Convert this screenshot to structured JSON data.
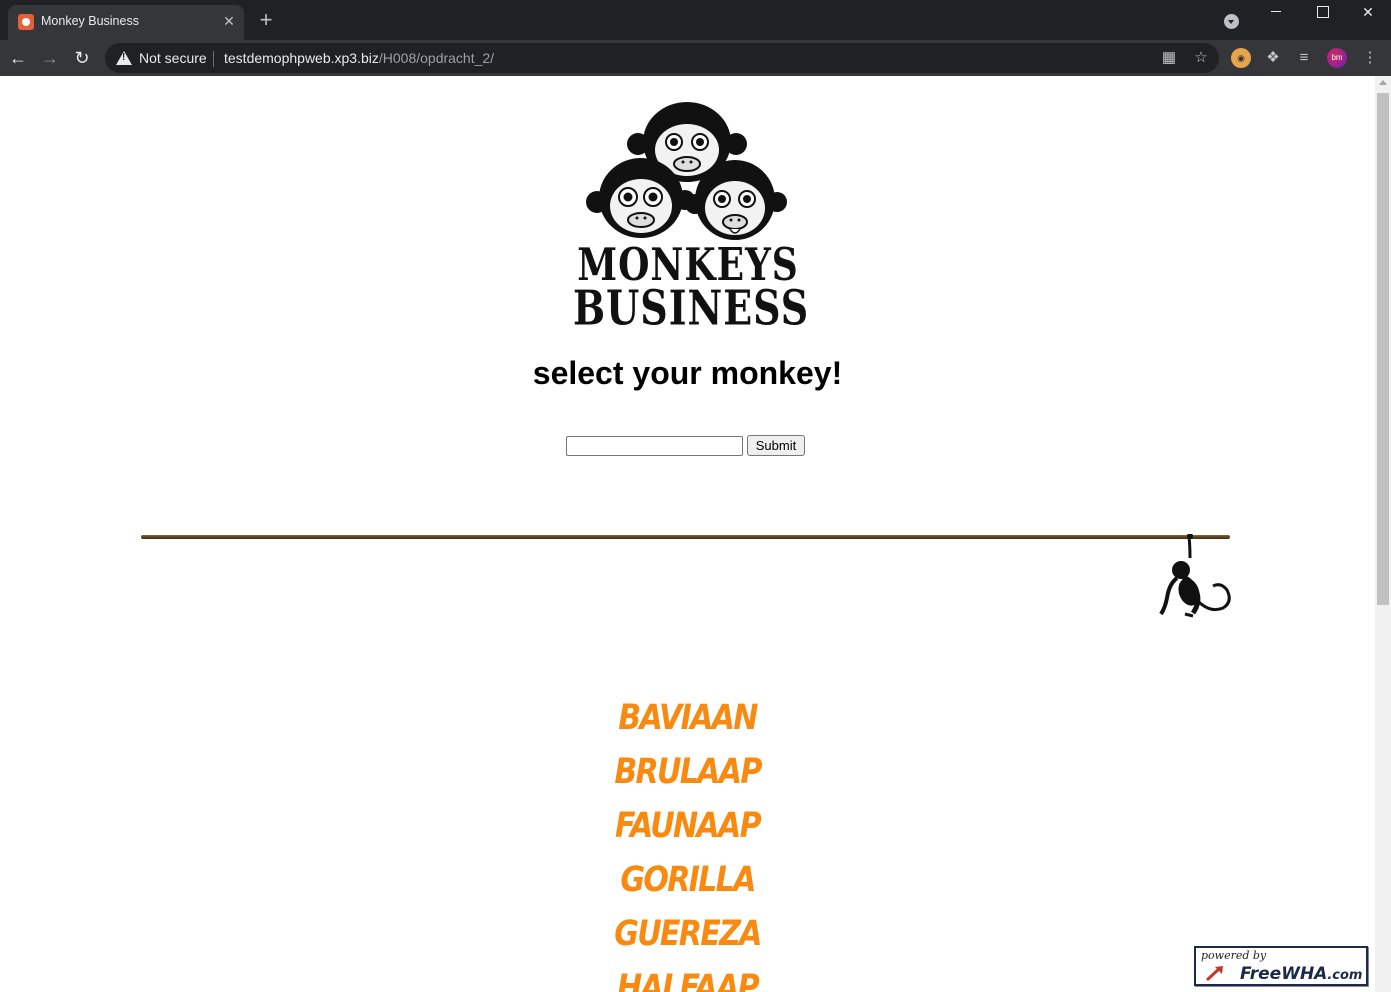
{
  "browser": {
    "tab_title": "Monkey Business",
    "tab_close": "✕",
    "new_tab": "+",
    "security_label": "Not secure",
    "url_host": "testdemophpweb.xp3.biz",
    "url_path": "/H008/opdracht_2/",
    "close_window": "✕",
    "avatar_initials": "bm"
  },
  "logo": {
    "line1": "MONKEYS",
    "line2": "BUSINESS"
  },
  "page": {
    "heading": "select your monkey!",
    "search_value": "",
    "submit_label": "Submit"
  },
  "monkeys": [
    "BAVIAAN",
    "BRULAAP",
    "FAUNAAP",
    "GORILLA",
    "GUEREZA",
    "HALFAAP"
  ],
  "footer_badge": {
    "powered_by": "powered by",
    "brand": "FreeWHA",
    "brand_suffix": ".com"
  },
  "colors": {
    "monkey_link": "#f98a11",
    "chrome_dark": "#202124",
    "chrome_toolbar": "#35363a"
  }
}
